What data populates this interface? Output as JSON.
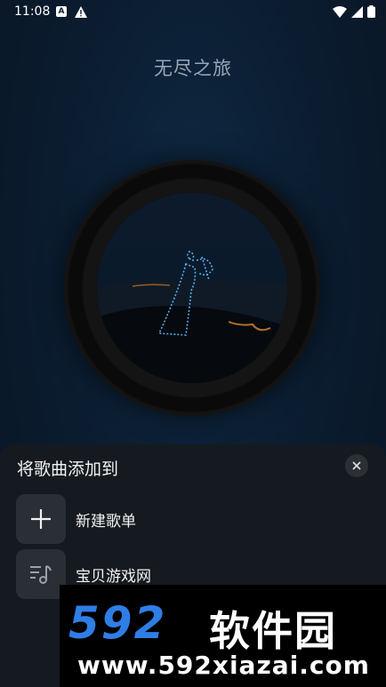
{
  "status_bar": {
    "time": "11:08"
  },
  "player": {
    "title": "无尽之旅"
  },
  "sheet": {
    "title": "将歌曲添加到",
    "items": [
      {
        "label": "新建歌单",
        "icon": "plus-icon"
      },
      {
        "label": "宝贝游戏网",
        "icon": "music-list-icon"
      }
    ]
  },
  "watermark": {
    "brand_number": "592",
    "brand_name": "软件园",
    "url": "www.592xiazai.com"
  },
  "colors": {
    "background": "#0b1d31",
    "sheet": "#151a20",
    "watermark_blue": "#2f7ee6"
  }
}
